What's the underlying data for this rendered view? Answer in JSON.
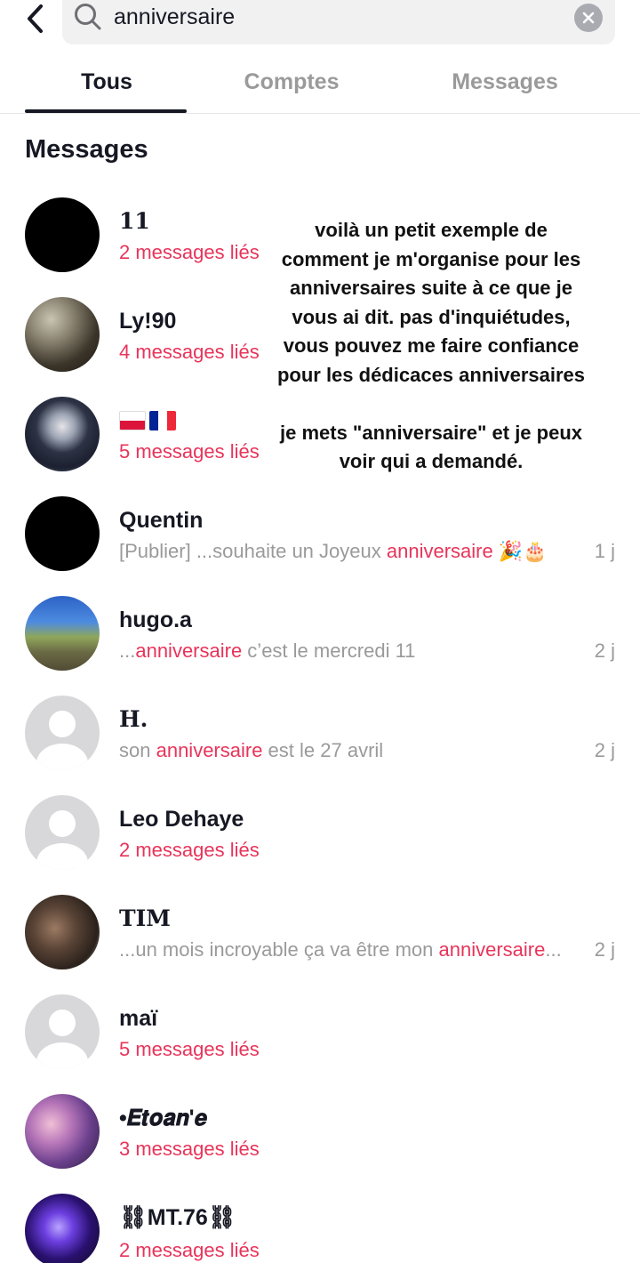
{
  "search": {
    "query": "anniversaire"
  },
  "icons": {
    "back": "chevron-left-icon",
    "search": "search-icon",
    "clear": "close-circle-icon"
  },
  "tabs": [
    {
      "label": "Tous",
      "active": true
    },
    {
      "label": "Comptes",
      "active": false
    },
    {
      "label": "Messages",
      "active": false
    }
  ],
  "section_title": "Messages",
  "colors": {
    "highlight": "#e8345a",
    "muted": "#9a9a9a",
    "text": "#161823"
  },
  "results": [
    {
      "name": "11",
      "subtitle": "2 messages liés",
      "time": ""
    },
    {
      "name": "Ly!90",
      "subtitle": "4 messages liés",
      "time": ""
    },
    {
      "name": "🇵🇱🇫🇷",
      "subtitle": "5 messages liés",
      "time": ""
    },
    {
      "name": "Quentin",
      "pre": "[Publier] ...souhaite un Joyeux ",
      "highlight": "anniversaire",
      "post": " 🎉🎂",
      "time": "1 j"
    },
    {
      "name": "hugo.a",
      "pre": "...",
      "highlight": "anniversaire",
      "post": " c’est le mercredi 11",
      "time": "2 j"
    },
    {
      "name": "H.",
      "pre": "son ",
      "highlight": "anniversaire",
      "post": " est le 27 avril",
      "time": "2 j"
    },
    {
      "name": "Leo Dehaye",
      "subtitle": "2 messages liés",
      "time": ""
    },
    {
      "name": "TIM",
      "pre": "...un mois incroyable ça va être mon ",
      "highlight": "anniversaire",
      "post": "...",
      "time": "2 j"
    },
    {
      "name": "maï",
      "subtitle": "5 messages liés",
      "time": ""
    },
    {
      "name": "•𝑬𝒕𝒐𝒂𝒏'𝒆",
      "subtitle": "3 messages liés",
      "time": ""
    },
    {
      "name": "⛓MT.76⛓",
      "subtitle": "2 messages liés",
      "time": ""
    }
  ],
  "caption": {
    "lines": [
      "voilà un petit exemple de",
      "comment je m'organise pour les",
      "anniversaires suite à ce que je",
      "vous ai dit. pas d'inquiétudes,",
      "vous pouvez me faire confiance",
      "pour les dédicaces anniversaires",
      "",
      "je mets \"anniversaire\" et je peux",
      "voir qui a demandé."
    ]
  }
}
